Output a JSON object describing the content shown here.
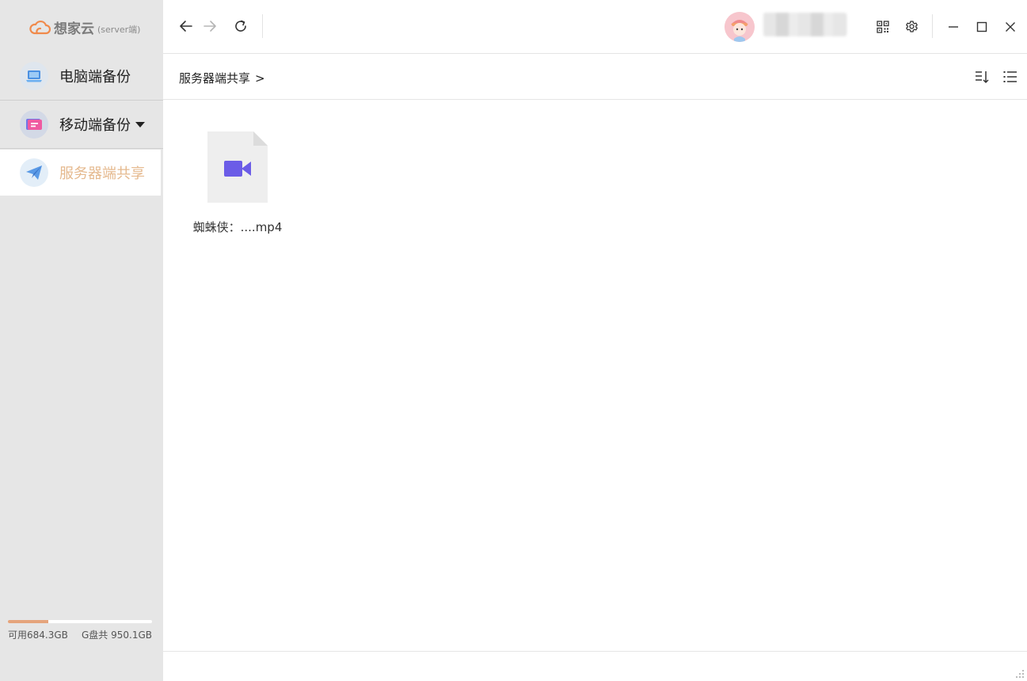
{
  "app": {
    "name": "想家云",
    "subtitle": "(server端)"
  },
  "sidebar": {
    "items": [
      {
        "label": "电脑端备份",
        "icon": "laptop-icon"
      },
      {
        "label": "移动端备份",
        "icon": "mobile-folder-icon",
        "has_dropdown": true
      },
      {
        "label": "服务器端共享",
        "icon": "paper-plane-icon",
        "active": true
      }
    ],
    "storage": {
      "available": "可用684.3GB",
      "total": "G盘共 950.1GB",
      "used_fraction": 0.28
    }
  },
  "toolbar": {
    "back_icon": "arrow-left-icon",
    "forward_icon": "arrow-right-icon",
    "refresh_icon": "refresh-icon",
    "qr_icon": "qr-code-icon",
    "settings_icon": "gear-icon",
    "minimize_icon": "minimize-icon",
    "maximize_icon": "maximize-icon",
    "close_icon": "close-icon"
  },
  "breadcrumb": {
    "path": "服务器端共享",
    "separator": ">"
  },
  "view_controls": {
    "sort_icon": "sort-icon",
    "list_view_icon": "list-view-icon"
  },
  "files": [
    {
      "name": "蜘蛛侠：....mp4",
      "type": "video",
      "icon": "video-camera-icon"
    }
  ],
  "colors": {
    "accent": "#e5b98e",
    "video_icon": "#6b5ce7",
    "storage_fill": "#e5a47c",
    "sidebar_bg": "#e6e6e6"
  }
}
